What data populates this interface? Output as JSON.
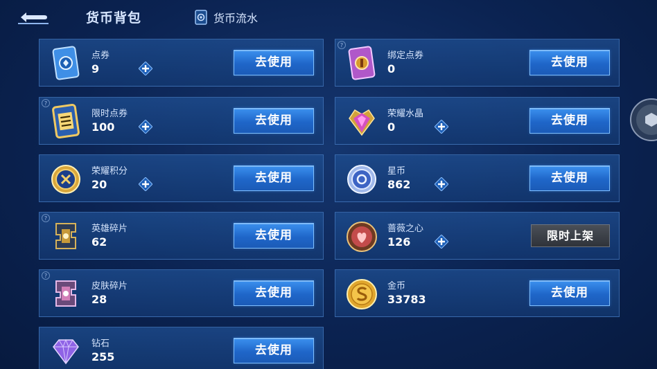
{
  "header": {
    "title": "货币背包",
    "flow_label": "货币流水"
  },
  "use_label": "去使用",
  "limited_label": "限时上架",
  "help_mark": "?",
  "items": [
    {
      "name": "点券",
      "value": "9"
    },
    {
      "name": "绑定点券",
      "value": "0"
    },
    {
      "name": "限时点券",
      "value": "100"
    },
    {
      "name": "荣耀水晶",
      "value": "0"
    },
    {
      "name": "荣耀积分",
      "value": "20"
    },
    {
      "name": "星币",
      "value": "862"
    },
    {
      "name": "英雄碎片",
      "value": "62"
    },
    {
      "name": "蔷薇之心",
      "value": "126"
    },
    {
      "name": "皮肤碎片",
      "value": "28"
    },
    {
      "name": "金币",
      "value": "33783"
    },
    {
      "name": "钻石",
      "value": "255"
    }
  ],
  "colors": {
    "background": "#0b2352",
    "card": "#1e4e91",
    "button": "#2a7ae0",
    "limited_button": "#3a3e45"
  },
  "icons": {
    "back": "back-arrow-icon",
    "flow": "currency-flow-icon",
    "plus": "plus-icon",
    "help": "help-icon"
  }
}
